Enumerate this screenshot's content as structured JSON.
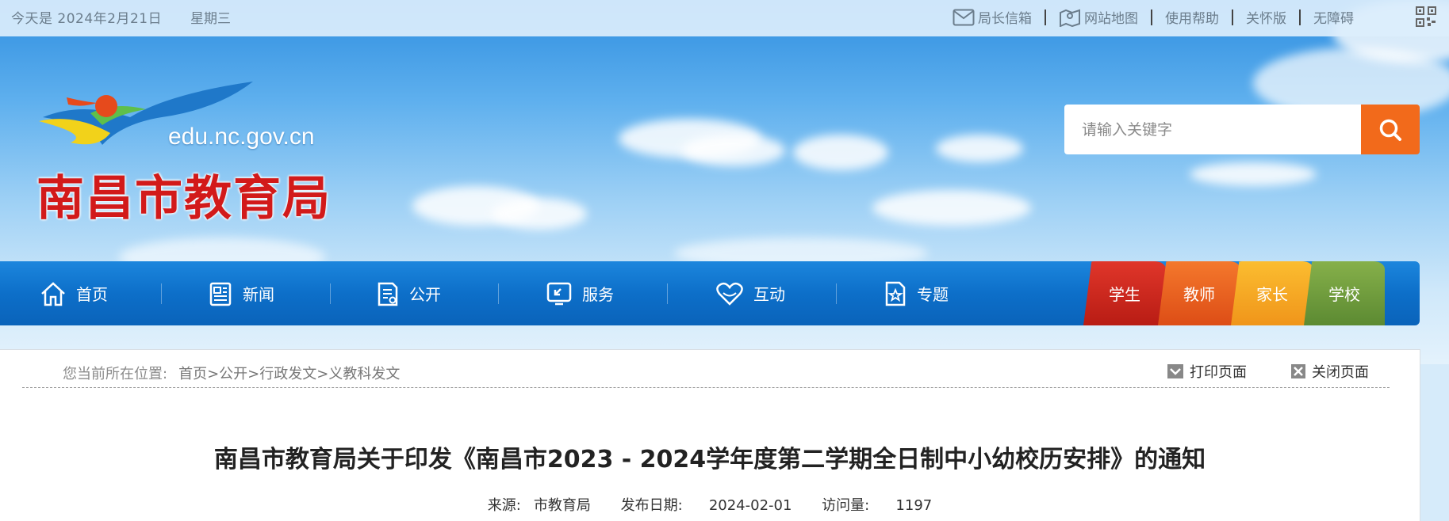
{
  "topbar": {
    "date": "今天是  2024年2月21日",
    "weekday": "星期三",
    "links": [
      {
        "label": "局长信箱",
        "icon": "mail-icon"
      },
      {
        "label": "网站地图",
        "icon": "map-icon"
      },
      {
        "label": "使用帮助"
      },
      {
        "label": "关怀版"
      },
      {
        "label": "无障碍"
      }
    ],
    "qr_icon": "qr-code-icon"
  },
  "logo": {
    "domain": "edu.nc.gov.cn",
    "name": "南昌市教育局"
  },
  "search": {
    "placeholder": "请输入关键字",
    "icon": "search-icon"
  },
  "nav": {
    "items": [
      {
        "label": "首页",
        "icon": "home-icon"
      },
      {
        "label": "新闻",
        "icon": "news-icon"
      },
      {
        "label": "公开",
        "icon": "document-icon"
      },
      {
        "label": "服务",
        "icon": "service-icon"
      },
      {
        "label": "互动",
        "icon": "heart-icon"
      },
      {
        "label": "专题",
        "icon": "star-doc-icon"
      }
    ],
    "roles": [
      {
        "label": "学生",
        "color": "#c8231a"
      },
      {
        "label": "教师",
        "color": "#e8561c"
      },
      {
        "label": "家长",
        "color": "#f5a21b"
      },
      {
        "label": "学校",
        "color": "#6c9a3a"
      }
    ]
  },
  "breadcrumb": {
    "lead": "您当前所在位置:",
    "path": [
      "首页",
      ">",
      "公开",
      ">",
      "行政发文",
      ">",
      "义教科发文"
    ]
  },
  "tools": {
    "print": "打印页面",
    "close": "关闭页面"
  },
  "article": {
    "title": "南昌市教育局关于印发《南昌市2023 - 2024学年度第二学期全日制中小幼校历安排》的通知",
    "source_label": "来源:",
    "source": "市教育局",
    "date_label": "发布日期:",
    "date": "2024-02-01",
    "views_label": "访问量:",
    "views": "1197"
  }
}
